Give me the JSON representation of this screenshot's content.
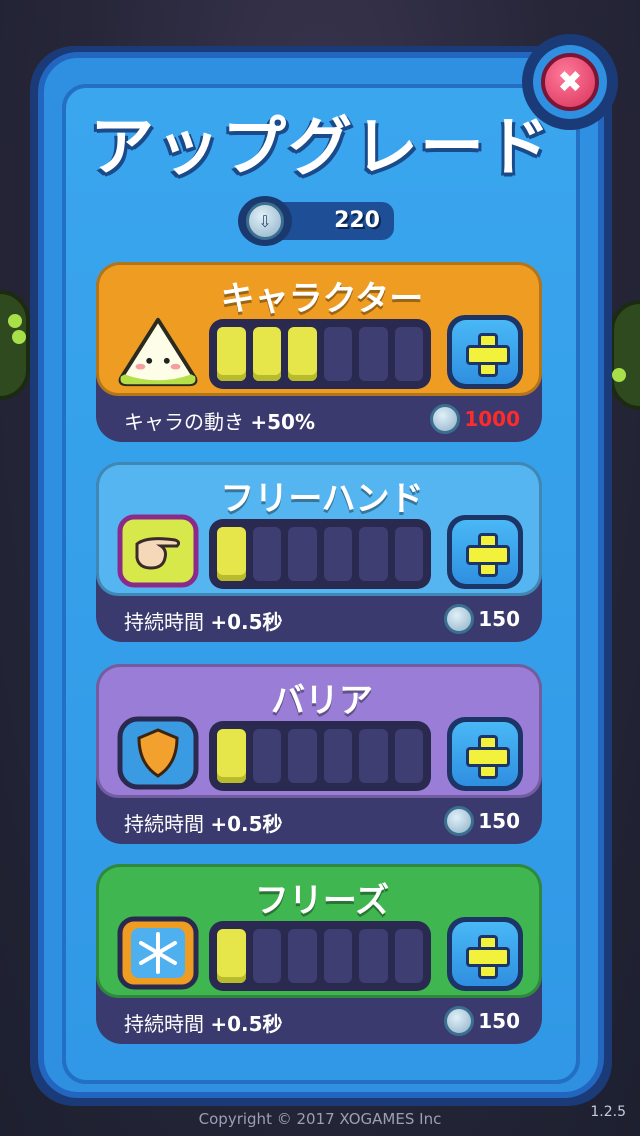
{
  "title": "アップグレード",
  "coins": {
    "value": "220"
  },
  "upgrades": [
    {
      "name": "キャラクター",
      "effect_label": "キャラの動き",
      "effect_value": "+50%",
      "cost": "1000",
      "level": 3,
      "max_level": 6,
      "color": "#ef9c22",
      "icon": "rice-ball-character-icon"
    },
    {
      "name": "フリーハンド",
      "effect_label": "持続時間",
      "effect_value": "+0.5秒",
      "cost": "150",
      "level": 1,
      "max_level": 6,
      "color": "#55b5f0",
      "icon": "pointing-hand-icon"
    },
    {
      "name": "バリア",
      "effect_label": "持続時間",
      "effect_value": "+0.5秒",
      "cost": "150",
      "level": 1,
      "max_level": 6,
      "color": "#9a7dd6",
      "icon": "shield-icon"
    },
    {
      "name": "フリーズ",
      "effect_label": "持続時間",
      "effect_value": "+0.5秒",
      "cost": "150",
      "level": 1,
      "max_level": 6,
      "color": "#3fb650",
      "icon": "snowflake-icon"
    }
  ],
  "footer": {
    "copyright": "Copyright © 2017 XOGAMES Inc",
    "version": "1.2.5"
  }
}
